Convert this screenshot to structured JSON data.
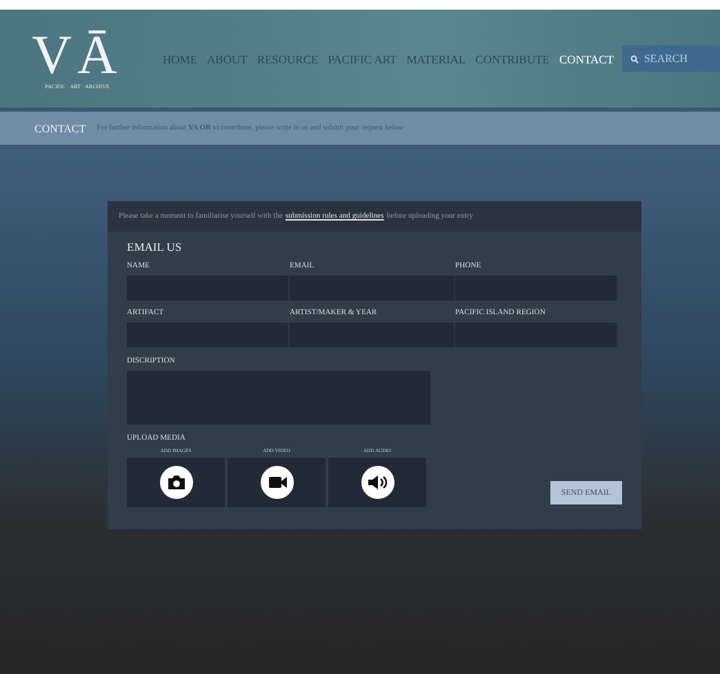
{
  "logo": {
    "mark": "VĀ",
    "tagline": "PACIFIC · ART · ARCHIVE"
  },
  "nav": [
    {
      "label": "HOME",
      "selected": false
    },
    {
      "label": "ABOUT",
      "selected": false
    },
    {
      "label": "RESOURCE",
      "selected": false
    },
    {
      "label": "PACIFIC ART",
      "selected": false
    },
    {
      "label": "MATERIAL",
      "selected": false
    },
    {
      "label": "CONTRIBUTE",
      "selected": false
    },
    {
      "label": "CONTACT",
      "selected": true
    }
  ],
  "search": {
    "placeholder": "SEARCH"
  },
  "subbar": {
    "title": "CONTACT",
    "text": "For further information about **VA OR** to contribute, please write to us and submit your request below"
  },
  "notice": {
    "before": "Please take a moment to familiarise yourself with the",
    "link": "submission rules and guidelines",
    "after": "before uploading your entry"
  },
  "form": {
    "title": "EMAIL US",
    "fields": [
      {
        "label": "NAME"
      },
      {
        "label": "EMAIL"
      },
      {
        "label": "PHONE"
      },
      {
        "label": "ARTIFACT"
      },
      {
        "label": "ARTIST/MAKER & YEAR"
      },
      {
        "label": "PACIFIC ISLAND REGION"
      }
    ],
    "description": {
      "label": "DISCRIPTION"
    },
    "upload": {
      "label": "UPLOAD MEDIA",
      "items": [
        {
          "kind": "image",
          "label": "ADD IMAGES"
        },
        {
          "kind": "video",
          "label": "ADD VIDEO"
        },
        {
          "kind": "audio",
          "label": "ADD AUDIO"
        }
      ]
    },
    "submit": "SEND EMAIL"
  }
}
